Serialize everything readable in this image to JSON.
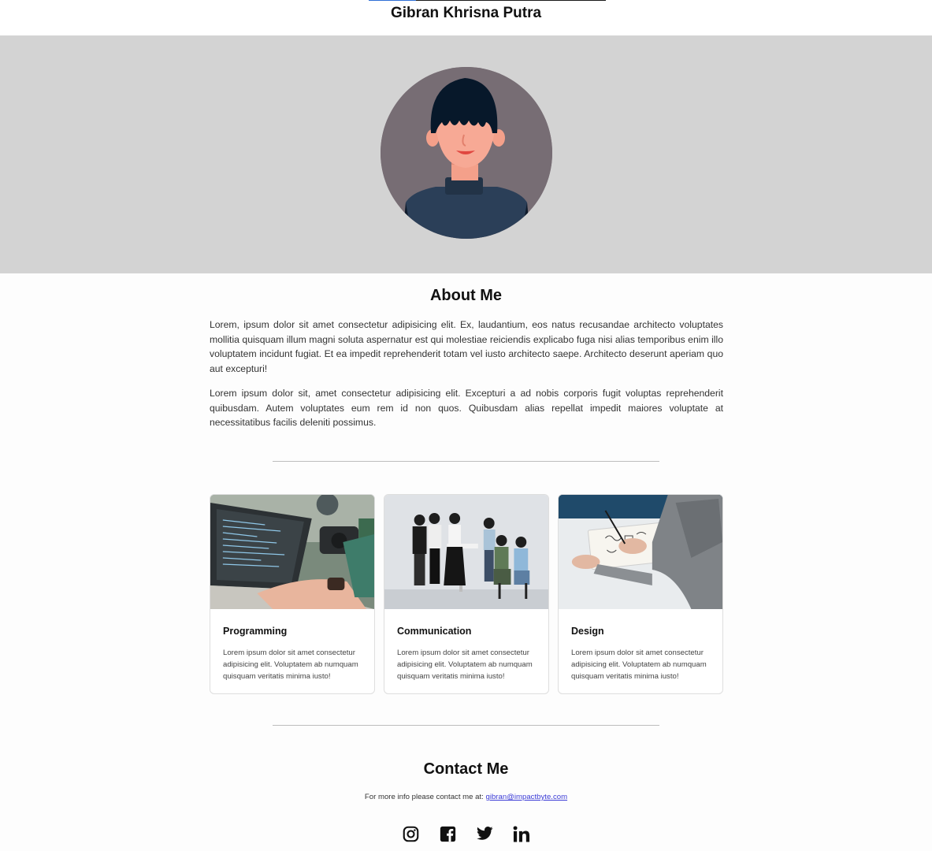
{
  "header": {
    "title": "Gibran Khrisna Putra"
  },
  "about": {
    "title": "About Me",
    "paragraphs": [
      "Lorem, ipsum dolor sit amet consectetur adipisicing elit. Ex, laudantium, eos natus recusandae architecto voluptates mollitia quisquam illum magni soluta aspernatur est qui molestiae reiciendis explicabo fuga nisi alias temporibus enim illo voluptatem incidunt fugiat. Et ea impedit reprehenderit totam vel iusto architecto saepe. Architecto deserunt aperiam quo aut excepturi!",
      "Lorem ipsum dolor sit, amet consectetur adipisicing elit. Excepturi a ad nobis corporis fugit voluptas reprehenderit quibusdam. Autem voluptates eum rem id non quos. Quibusdam alias repellat impedit maiores voluptate at necessitatibus facilis deleniti possimus."
    ]
  },
  "skills": [
    {
      "title": "Programming",
      "text": "Lorem ipsum dolor sit amet consectetur adipisicing elit. Voluptatem ab numquam quisquam veritatis minima iusto!",
      "icon": "laptop-photo"
    },
    {
      "title": "Communication",
      "text": "Lorem ipsum dolor sit amet consectetur adipisicing elit. Voluptatem ab numquam quisquam veritatis minima iusto!",
      "icon": "team-meeting-photo"
    },
    {
      "title": "Design",
      "text": "Lorem ipsum dolor sit amet consectetur adipisicing elit. Voluptatem ab numquam quisquam veritatis minima iusto!",
      "icon": "sketching-photo"
    }
  ],
  "contact": {
    "title": "Contact Me",
    "text": "For more info please contact me at: ",
    "email": "gibran@impactbyte.com"
  },
  "socials": [
    {
      "name": "instagram",
      "icon": "instagram-icon"
    },
    {
      "name": "facebook",
      "icon": "facebook-icon"
    },
    {
      "name": "twitter",
      "icon": "twitter-icon"
    },
    {
      "name": "linkedin",
      "icon": "linkedin-icon"
    }
  ],
  "colors": {
    "hero_bg": "#d3d3d3",
    "avatar_bg": "#776d74",
    "link": "#3b3bd6"
  }
}
